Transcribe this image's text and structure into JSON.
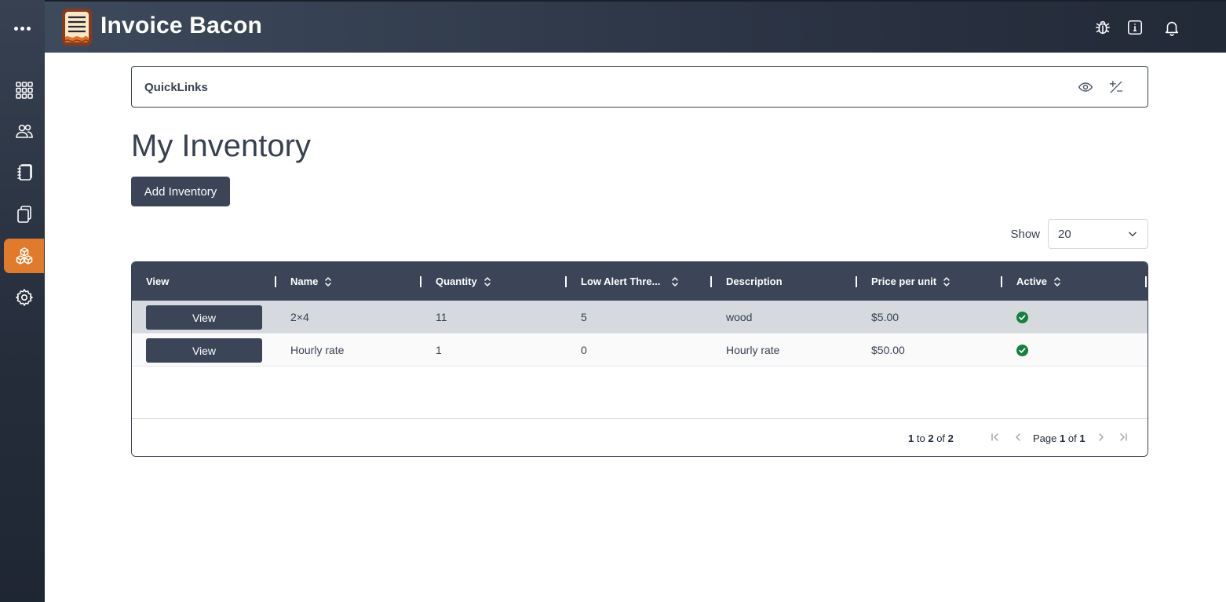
{
  "app": {
    "title": "Invoice Bacon"
  },
  "sidebar": {
    "items": [
      {
        "name": "dashboard",
        "icon": "grid-icon",
        "active": false
      },
      {
        "name": "customers",
        "icon": "users-icon",
        "active": false
      },
      {
        "name": "invoices",
        "icon": "notebook-icon",
        "active": false
      },
      {
        "name": "estimates",
        "icon": "copy-icon",
        "active": false
      },
      {
        "name": "inventory",
        "icon": "boxes-icon",
        "active": true
      },
      {
        "name": "settings",
        "icon": "gear-icon",
        "active": false
      }
    ],
    "active_color": "#e07b2c"
  },
  "topbar": {
    "icons": [
      "bug-icon",
      "info-icon",
      "bell-icon"
    ]
  },
  "quicklinks": {
    "label": "QuickLinks"
  },
  "page": {
    "title": "My Inventory",
    "add_label": "Add Inventory",
    "show_label": "Show",
    "show_value": "20"
  },
  "table": {
    "columns": [
      {
        "label": "View",
        "sortable": false
      },
      {
        "label": "Name",
        "sortable": true
      },
      {
        "label": "Quantity",
        "sortable": true
      },
      {
        "label": "Low Alert Thre...",
        "sortable": true
      },
      {
        "label": "Description",
        "sortable": false
      },
      {
        "label": "Price per unit",
        "sortable": true
      },
      {
        "label": "Active",
        "sortable": true
      }
    ],
    "view_label": "View",
    "rows": [
      {
        "name": "2×4",
        "quantity": "11",
        "low_alert": "5",
        "description": "wood",
        "price": "$5.00",
        "active": true
      },
      {
        "name": "Hourly rate",
        "quantity": "1",
        "low_alert": "0",
        "description": "Hourly rate",
        "price": "$50.00",
        "active": true
      }
    ]
  },
  "pagination": {
    "from": "1",
    "to_word": "to",
    "to": "2",
    "of_word": "of",
    "total": "2",
    "page_word": "Page",
    "page": "1",
    "page_of_word": "of",
    "pages": "1"
  },
  "colors": {
    "header_bg": "#3b4557",
    "accent": "#e07b2c",
    "active_check": "#15803d"
  }
}
